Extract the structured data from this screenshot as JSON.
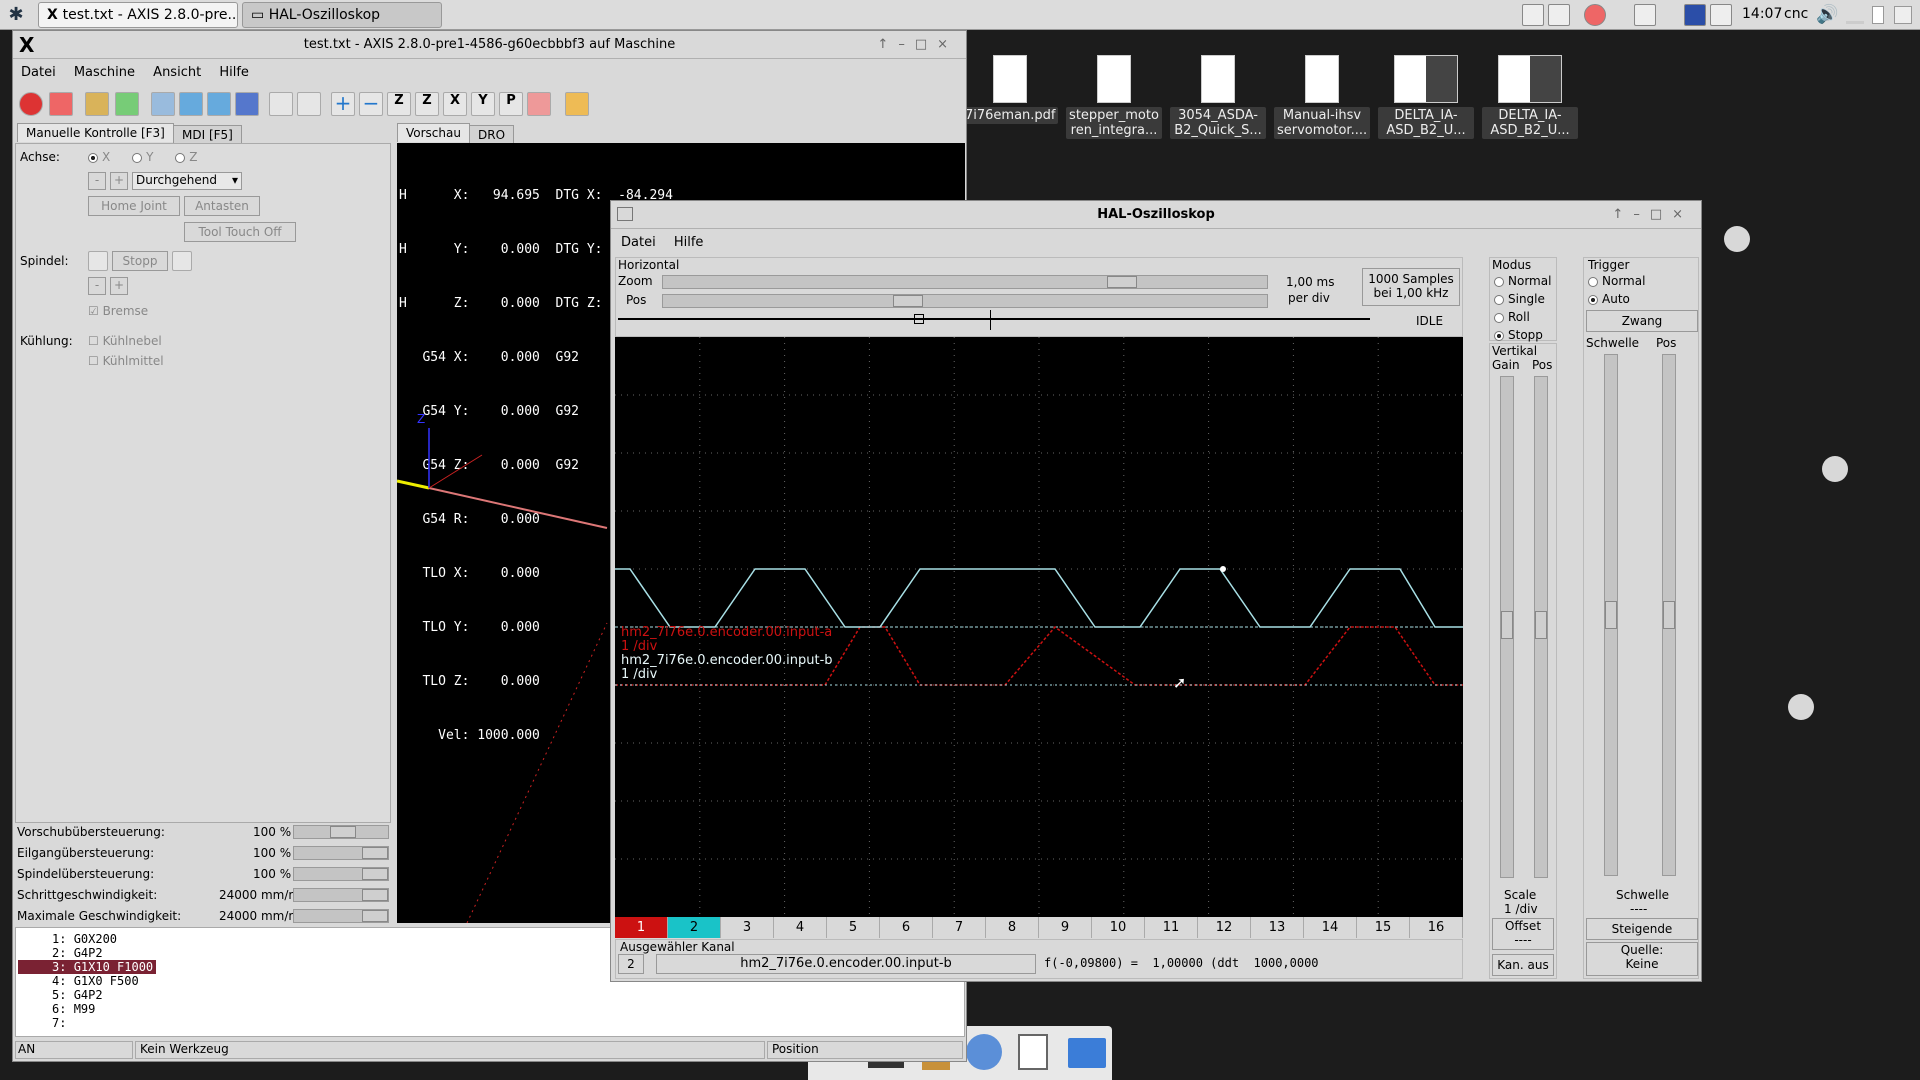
{
  "taskbar": {
    "tasks": [
      {
        "label": "test.txt - AXIS 2.8.0-pre...",
        "active": true
      },
      {
        "label": "HAL-Oszilloskop",
        "active": false
      }
    ],
    "clock": "14:07",
    "user": "cnc"
  },
  "desktop": {
    "icons": [
      {
        "label": "7i76eman.pdf"
      },
      {
        "label": "stepper_moto ren_integra..."
      },
      {
        "label": "3054_ASDA-B2_Quick_S..."
      },
      {
        "label": "Manual-ihsv servomotor...."
      },
      {
        "label": "DELTA_IA-ASD_B2_U..."
      },
      {
        "label": "DELTA_IA-ASD_B2_U..."
      }
    ]
  },
  "axis": {
    "title": "test.txt - AXIS 2.8.0-pre1-4586-g60ecbbbf3 auf  Maschine",
    "menu": [
      "Datei",
      "Maschine",
      "Ansicht",
      "Hilfe"
    ],
    "tabs_left": [
      "Manuelle Kontrolle [F3]",
      "MDI [F5]"
    ],
    "tabs_right": [
      "Vorschau",
      "DRO"
    ],
    "achse_label": "Achse:",
    "axes": [
      "X",
      "Y",
      "Z"
    ],
    "jog_minus": "-",
    "jog_plus": "+",
    "jog_mode": "Durchgehend",
    "home_joint": "Home Joint",
    "antasten": "Antasten",
    "tool_touch_off": "Tool Touch Off",
    "spindel_label": "Spindel:",
    "spindel_stopp": "Stopp",
    "bremse": "Bremse",
    "kuehlung_label": "Kühlung:",
    "kuehlnebel": "Kühlnebel",
    "kuehlmittel": "Kühlmittel",
    "overrides": [
      {
        "label": "Vorschubübersteuerung:",
        "value": "100 %"
      },
      {
        "label": "Eilgangübersteuerung:",
        "value": "100 %"
      },
      {
        "label": "Spindelübersteuerung:",
        "value": "100 %"
      },
      {
        "label": "Schrittgeschwindigkeit:",
        "value": "24000 mm/min"
      },
      {
        "label": "Maximale Geschwindigkeit:",
        "value": "24000 mm/min"
      }
    ],
    "dro_lines": [
      "H      X:   94.695  DTG X:  -84.294",
      "H      Y:    0.000  DTG Y:    0.000",
      "H      Z:    0.000  DTG Z:    0.000",
      "   G54 X:    0.000  G92",
      "   G54 Y:    0.000  G92",
      "   G54 Z:    0.000  G92",
      "   G54 R:    0.000",
      "   TLO X:    0.000",
      "   TLO Y:    0.000",
      "   TLO Z:    0.000",
      "     Vel: 1000.000"
    ],
    "gcode": [
      {
        "n": "1:",
        "code": "G0X200"
      },
      {
        "n": "2:",
        "code": "G4P2"
      },
      {
        "n": "3:",
        "code": "G1X10 F1000"
      },
      {
        "n": "4:",
        "code": "G1X0 F500"
      },
      {
        "n": "5:",
        "code": "G4P2"
      },
      {
        "n": "6:",
        "code": "M99"
      },
      {
        "n": "7:",
        "code": ""
      }
    ],
    "status_state": "AN",
    "status_tool": "Kein Werkzeug",
    "status_position": "Position"
  },
  "scope": {
    "title": "HAL-Oszilloskop",
    "menu": [
      "Datei",
      "Hilfe"
    ],
    "horizontal_label": "Horizontal",
    "zoom_label": "Zoom",
    "pos_label": "Pos",
    "timebase": "1,00 ms",
    "timebase_unit": "per div",
    "samples": "1000 Samples",
    "rate": "bei 1,00 kHz",
    "state": "IDLE",
    "traces": [
      {
        "name": "hm2_7i76e.0.encoder.00.input-a",
        "scale": "1 /div",
        "color": "#cc1111"
      },
      {
        "name": "hm2_7i76e.0.encoder.00.input-b",
        "scale": "1 /div",
        "color": "#a8e0e6"
      }
    ],
    "channels": [
      "1",
      "2",
      "3",
      "4",
      "5",
      "6",
      "7",
      "8",
      "9",
      "10",
      "11",
      "12",
      "13",
      "14",
      "15",
      "16"
    ],
    "selected_label": "Ausgewähler Kanal",
    "selected_num": "2",
    "selected_name": "hm2_7i76e.0.encoder.00.input-b",
    "readout": "f(-0,09800) =  1,00000 (ddt  1000,0000",
    "modus_label": "Modus",
    "modes": [
      "Normal",
      "Single",
      "Roll",
      "Stopp"
    ],
    "mode_selected": "Stopp",
    "vertikal_label": "Vertikal",
    "gain_label": "Gain",
    "vpos_label": "Pos",
    "scale_label": "Scale",
    "scale_value": "1 /div",
    "offset_label": "Offset",
    "offset_value": "----",
    "kan_aus": "Kan. aus",
    "trigger_label": "Trigger",
    "trigger_modes": [
      "Normal",
      "Auto"
    ],
    "trigger_selected": "Auto",
    "zwang": "Zwang",
    "schwelle_label": "Schwelle",
    "tpos_label": "Pos",
    "schwelle_value_label": "Schwelle",
    "schwelle_value": "----",
    "steigende": "Steigende",
    "quelle_label": "Quelle:",
    "quelle_value": "Keine"
  }
}
